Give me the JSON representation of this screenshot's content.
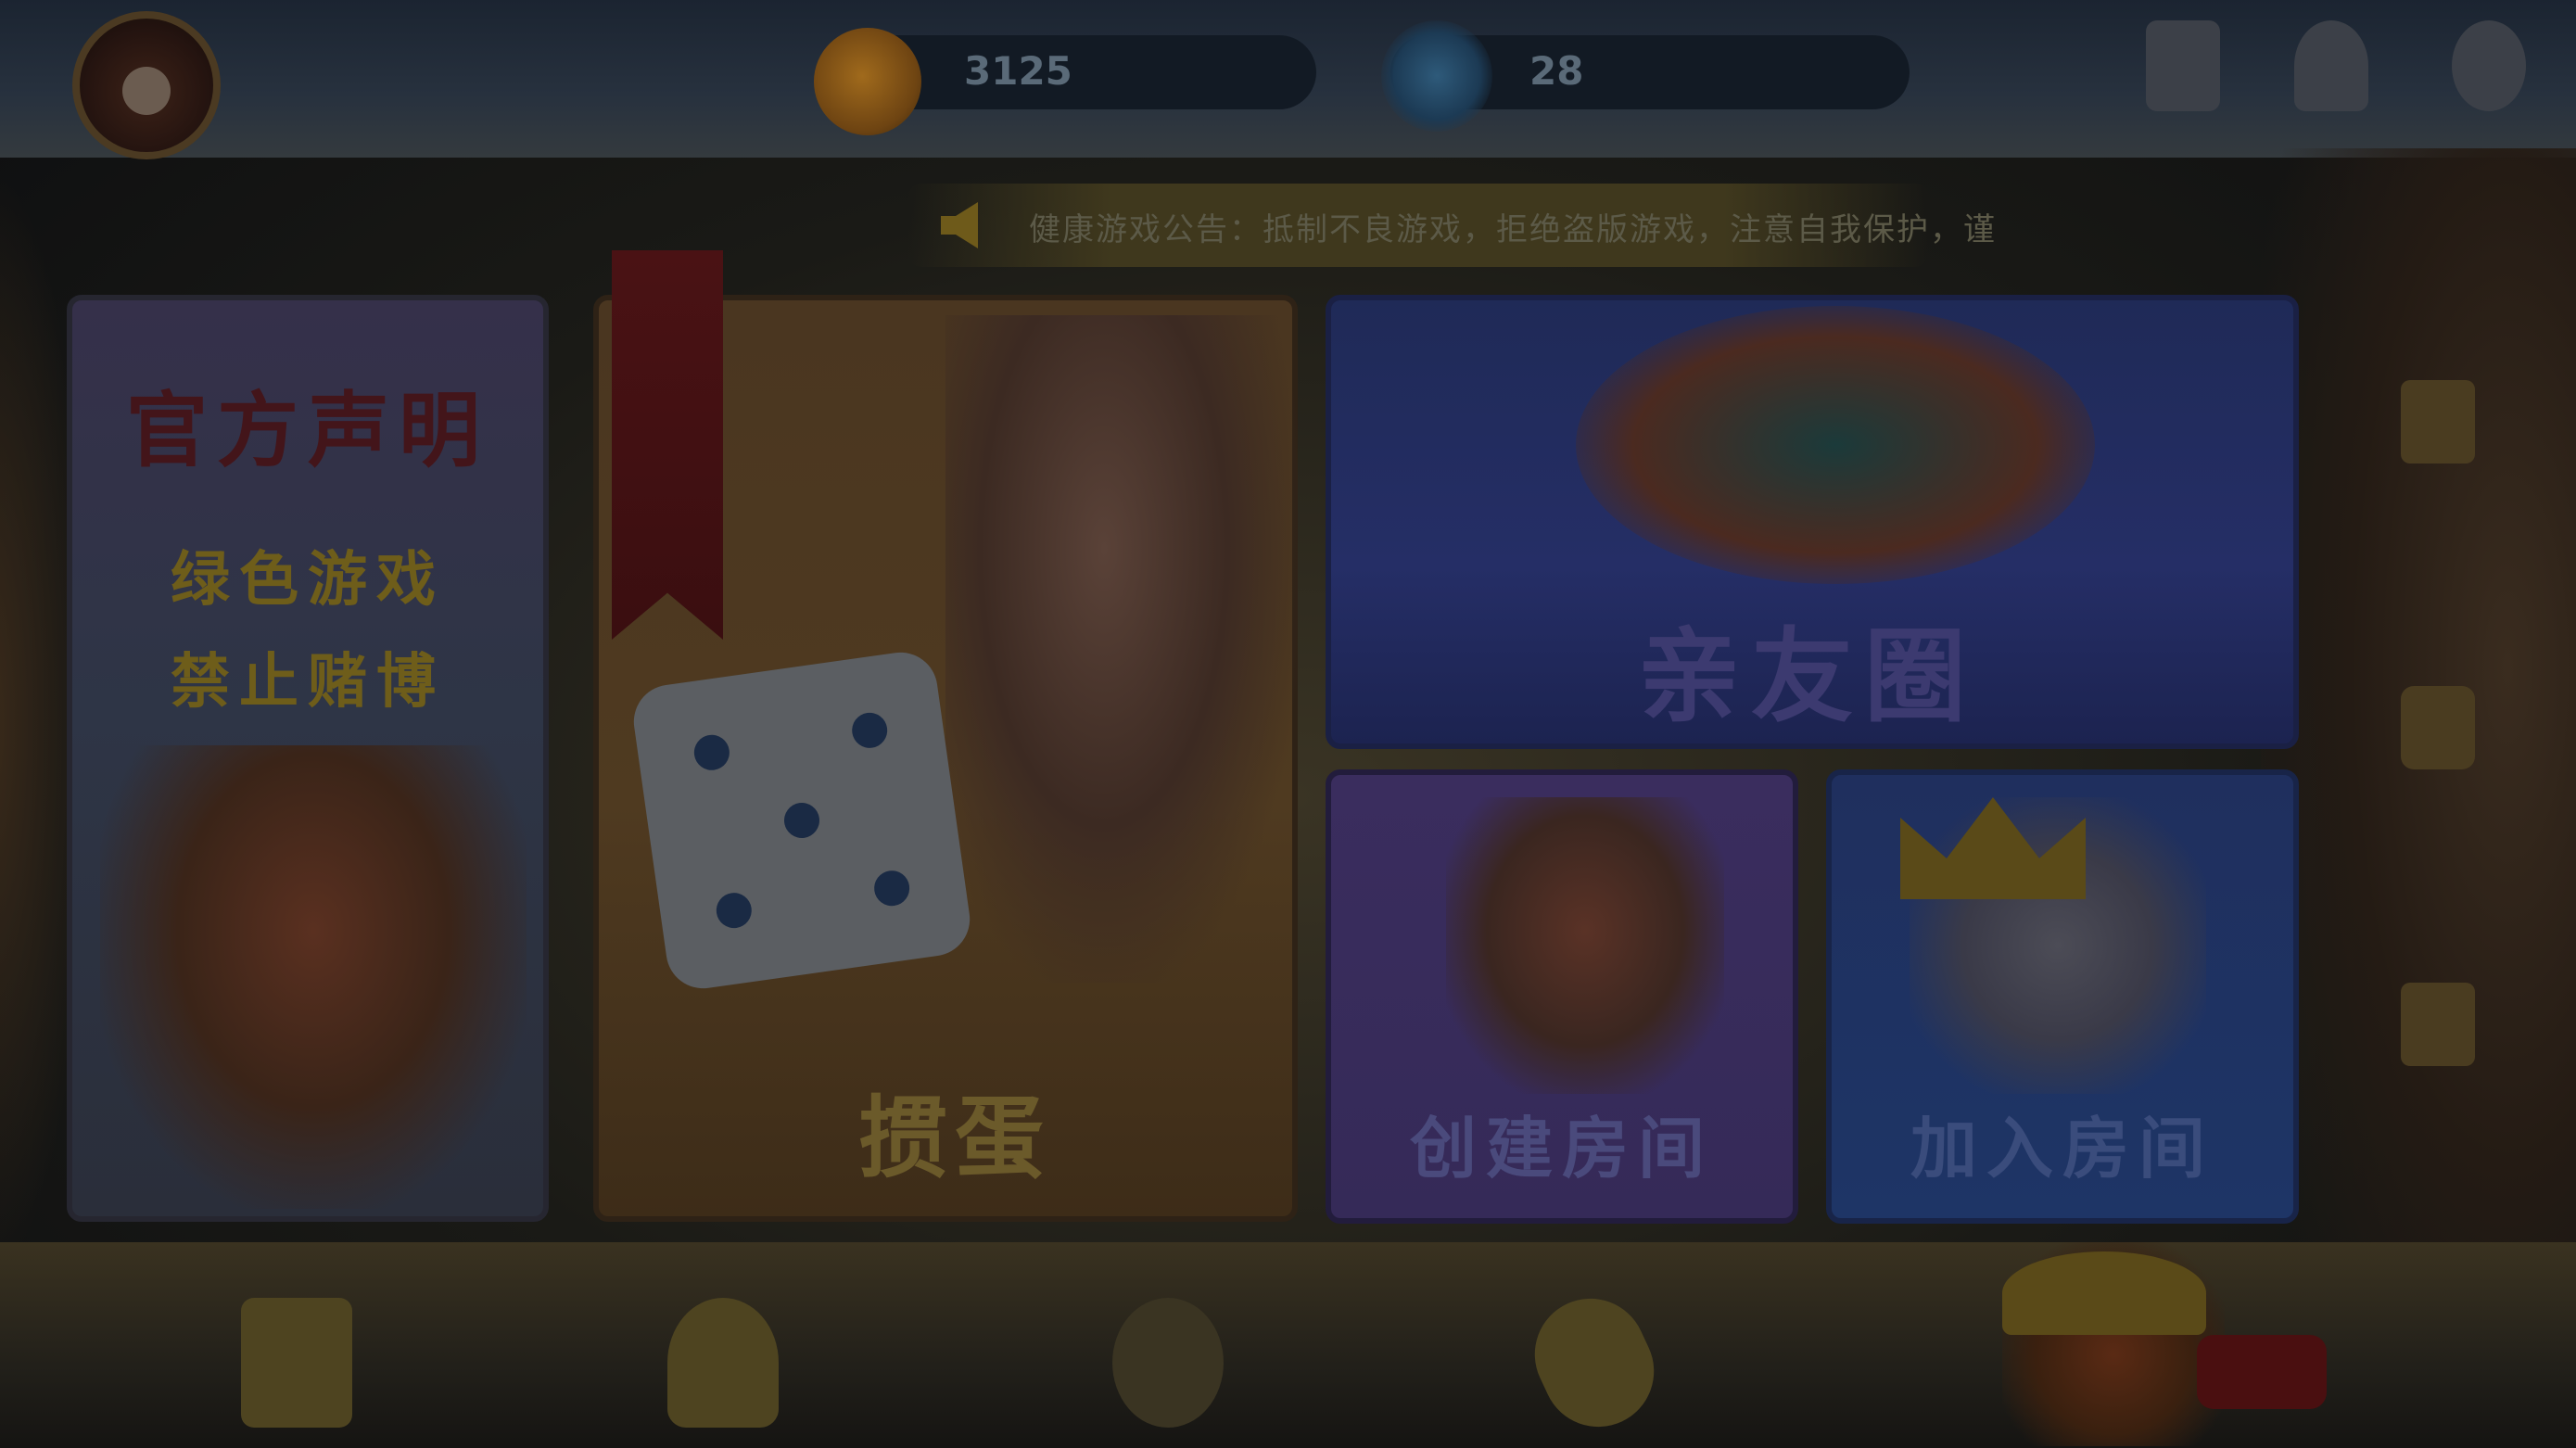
{
  "header": {
    "player_name": "",
    "player_id": "",
    "gold_value": "3125",
    "diamond_value": "28",
    "top_icons": [
      {
        "name": "rules-icon",
        "label": ""
      },
      {
        "name": "service-icon",
        "label": ""
      },
      {
        "name": "settings-icon",
        "label": ""
      }
    ]
  },
  "notice": {
    "text": "健康游戏公告：抵制不良游戏，拒绝盗版游戏，注意自我保护，谨"
  },
  "panels": {
    "announce": {
      "title": "官方声明",
      "line1": "绿色游戏",
      "line2": "禁止赌博"
    },
    "dice_game": {
      "ribbon": "",
      "title": "掼蛋"
    },
    "friends_room": {
      "title": "亲友圈"
    },
    "create_room": {
      "title": "创建房间"
    },
    "join_room": {
      "title": "加入房间"
    }
  },
  "side_menu": [
    {
      "name": "side-item-1",
      "label": ""
    },
    {
      "name": "side-item-2",
      "label": ""
    },
    {
      "name": "side-item-3",
      "label": ""
    }
  ],
  "bottom_bar": [
    {
      "name": "bottom-item-1",
      "label": ""
    },
    {
      "name": "bottom-item-2",
      "label": ""
    },
    {
      "name": "bottom-item-3",
      "label": ""
    },
    {
      "name": "bottom-item-4",
      "label": ""
    }
  ],
  "shop": {
    "badge": ""
  },
  "colors": {
    "overlay": "#0d1118",
    "gold_text": "#6b5a2a",
    "friends_bg": "#252e66",
    "create_bg": "#352a58",
    "join_bg": "#1e3566"
  }
}
